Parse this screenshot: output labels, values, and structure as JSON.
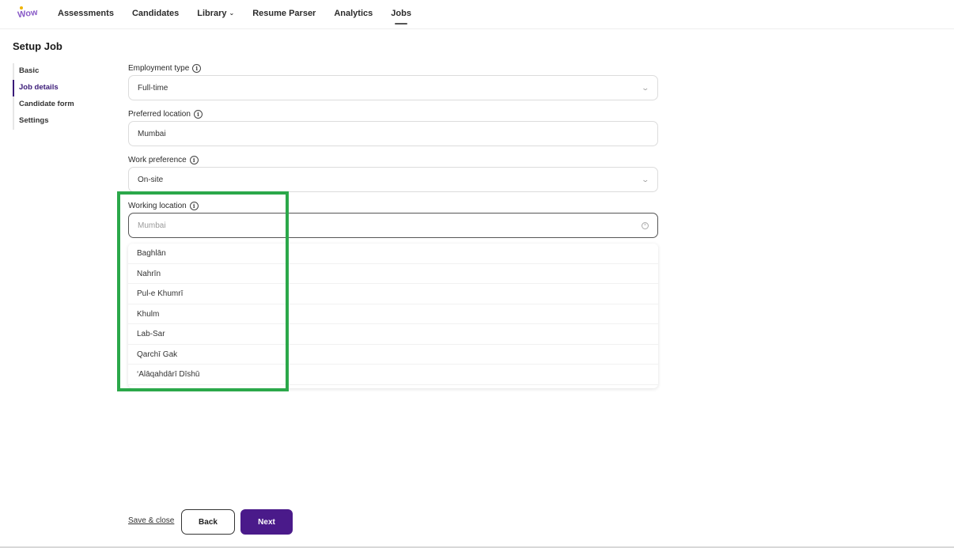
{
  "nav": {
    "logo_name": "brand-logo",
    "items": [
      {
        "label": "Assessments"
      },
      {
        "label": "Candidates"
      },
      {
        "label": "Library",
        "has_dropdown": true
      },
      {
        "label": "Resume Parser"
      },
      {
        "label": "Analytics"
      },
      {
        "label": "Jobs",
        "active": true
      }
    ]
  },
  "page": {
    "title": "Setup Job"
  },
  "stepper": {
    "steps": [
      {
        "label": "Basic"
      },
      {
        "label": "Job details",
        "active": true
      },
      {
        "label": "Candidate form"
      },
      {
        "label": "Settings"
      }
    ]
  },
  "form": {
    "employment_type": {
      "label": "Employment type",
      "value": "Full-time"
    },
    "preferred_location": {
      "label": "Preferred location",
      "value": "Mumbai"
    },
    "work_preference": {
      "label": "Work preference",
      "value": "On-site"
    },
    "working_location": {
      "label": "Working location",
      "placeholder": "Mumbai"
    }
  },
  "dropdown": {
    "options": [
      "Baghlān",
      "Nahrīn",
      "Pul-e Khumrī",
      "Khulm",
      "Lab-Sar",
      "Qarchī Gak",
      "‘Alāqahdārī Dīshū"
    ]
  },
  "actions": {
    "save_close": "Save & close",
    "back": "Back",
    "next": "Next"
  },
  "colors": {
    "accent": "#4a1a8a",
    "highlight": "#2ba84a"
  }
}
